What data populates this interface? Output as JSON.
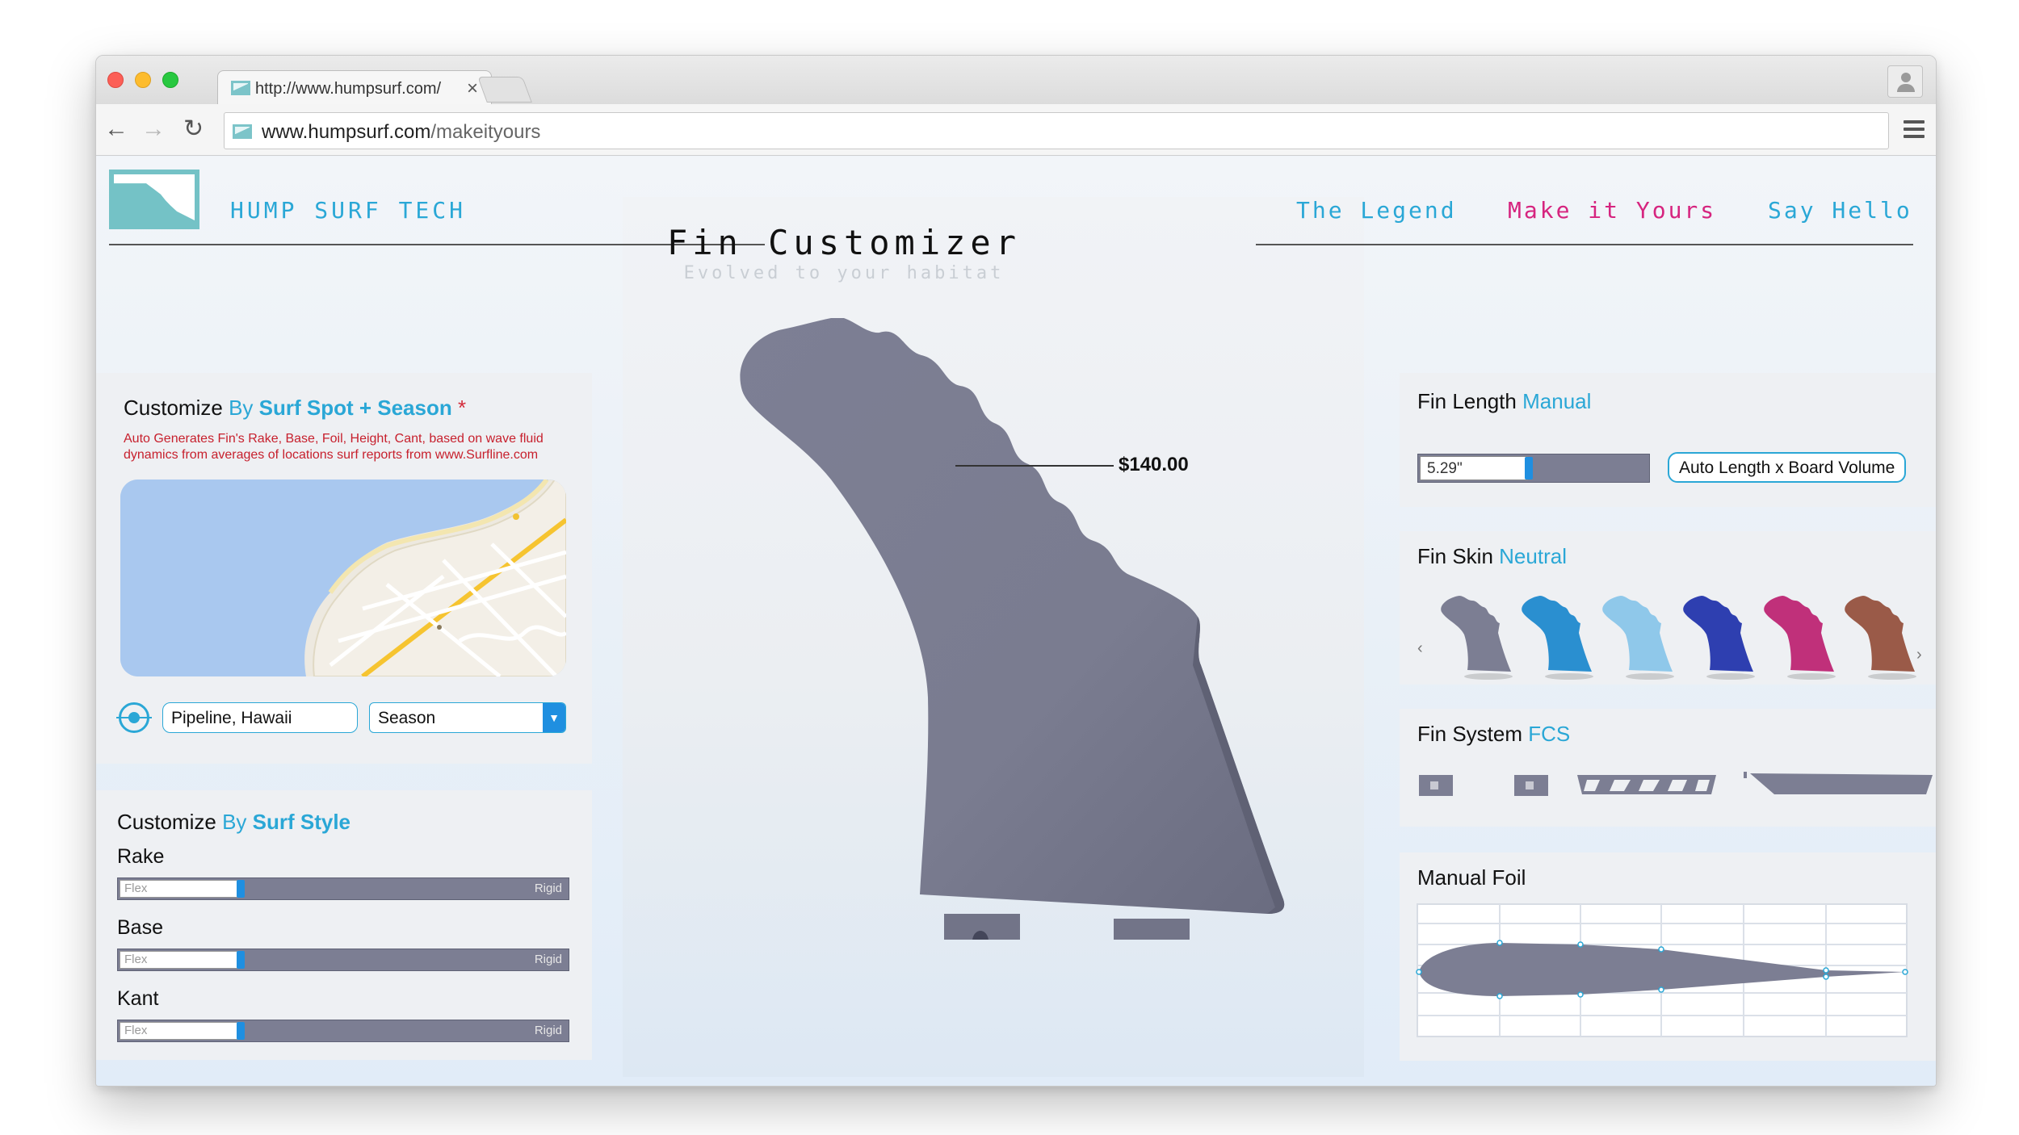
{
  "browser": {
    "tab_title": "http://www.humpsurf.com/",
    "tab_close": "×",
    "url_host": "www.humpsurf.com",
    "url_path": "/makeityours",
    "back": "←",
    "forward": "→",
    "reload": "↻"
  },
  "site": {
    "brand": "HUMP SURF TECH",
    "nav": [
      {
        "label": "The Legend",
        "color": "#2aa7d6"
      },
      {
        "label": "Make it Yours",
        "color": "#d6247f"
      },
      {
        "label": "Say Hello",
        "color": "#2aa7d6"
      }
    ]
  },
  "hero": {
    "title": "Fin Customizer",
    "subtitle": "Evolved to your habitat",
    "price": "$140.00"
  },
  "spot_panel": {
    "title_prefix": "Customize",
    "title_by": "By",
    "title_highlight": "Surf Spot + Season",
    "title_star": "*",
    "description_line1": "Auto Generates Fin's Rake, Base, Foil, Height, Cant,  based on wave fluid",
    "description_line2": "dynamics from averages of locations surf reports from www.Surfline.com",
    "location_value": "Pipeline, Hawaii",
    "season_value": "Season"
  },
  "style_panel": {
    "title_prefix": "Customize",
    "title_by": "By",
    "title_highlight": "Surf Style",
    "sliders": [
      {
        "label": "Rake",
        "left": "Flex",
        "right": "Rigid",
        "value": 0.27
      },
      {
        "label": "Base",
        "left": "Flex",
        "right": "Rigid",
        "value": 0.27
      },
      {
        "label": "Kant",
        "left": "Flex",
        "right": "Rigid",
        "value": 0.27
      }
    ]
  },
  "length_panel": {
    "title": "Fin Length",
    "mode": "Manual",
    "value": "5.29\"",
    "auto_button": "Auto Length x Board Volume"
  },
  "skin_panel": {
    "title": "Fin Skin",
    "selected": "Neutral",
    "prev": "‹",
    "next": "›",
    "skins": [
      {
        "name": "neutral",
        "color": "#7c7e93"
      },
      {
        "name": "blue-wave",
        "color": "#2a8fd0"
      },
      {
        "name": "sky-pastel",
        "color": "#8fc8ea"
      },
      {
        "name": "deep-blue",
        "color": "#2e3fb0"
      },
      {
        "name": "magenta",
        "color": "#c0307a"
      },
      {
        "name": "coral-rust",
        "color": "#9a5a48"
      }
    ]
  },
  "system_panel": {
    "title": "Fin System",
    "selected": "FCS"
  },
  "foil_panel": {
    "title": "Manual Foil"
  },
  "colors": {
    "accent": "#2aa7d6",
    "fin_gray": "#7c7e93",
    "nav_active": "#d6247f"
  }
}
